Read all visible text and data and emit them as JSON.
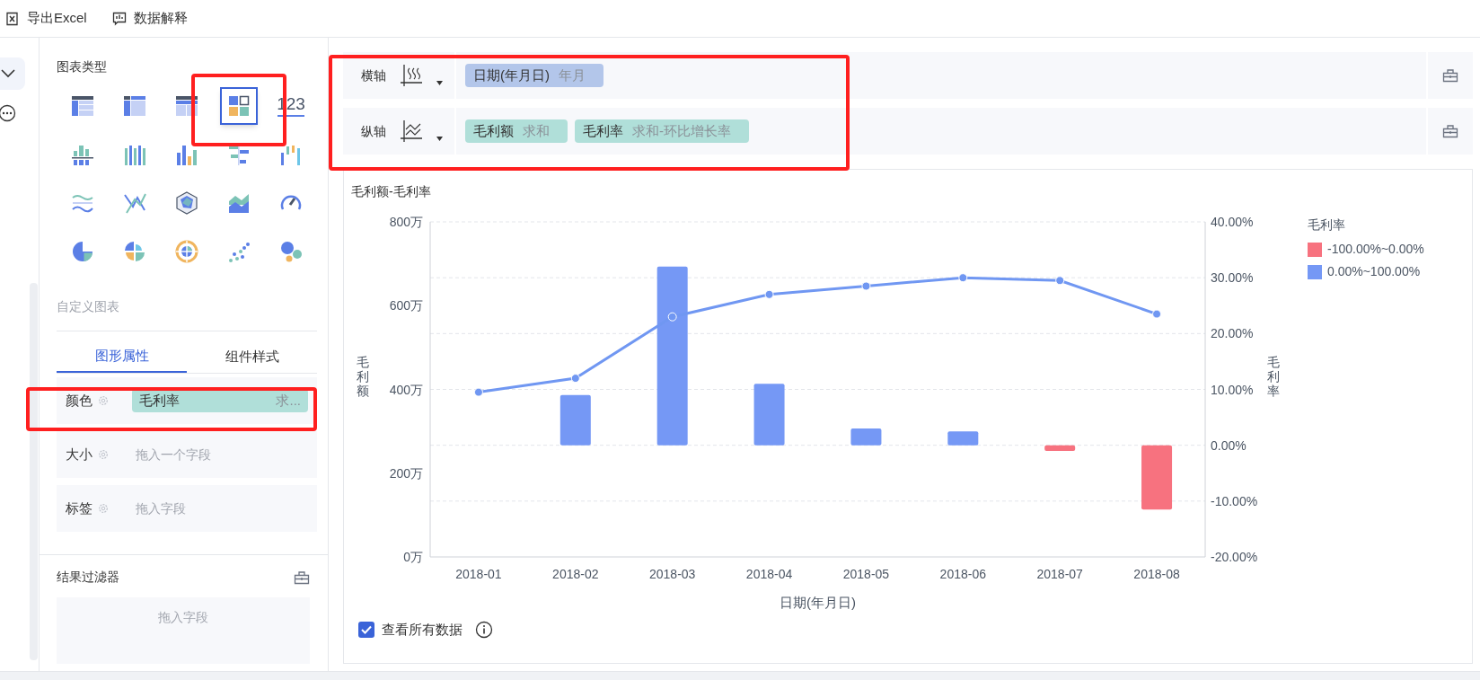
{
  "toolbar": [
    {
      "kind": "excel",
      "label": "导出Excel"
    },
    {
      "kind": "explain",
      "label": "数据解释"
    }
  ],
  "chart_types_title": "图表类型",
  "chart_types": [
    {
      "kind": "table",
      "selected": false
    },
    {
      "kind": "split-table",
      "selected": false
    },
    {
      "kind": "header-table",
      "selected": false
    },
    {
      "kind": "card-grid",
      "selected": true
    },
    {
      "kind": "number",
      "label": "123",
      "selected": false
    },
    {
      "kind": "stacked-bar",
      "selected": false
    },
    {
      "kind": "grouped-bar",
      "selected": false
    },
    {
      "kind": "column",
      "selected": false
    },
    {
      "kind": "diverging-bar",
      "selected": false
    },
    {
      "kind": "waterfall",
      "selected": false
    },
    {
      "kind": "waves",
      "selected": false
    },
    {
      "kind": "cross-lines",
      "selected": false
    },
    {
      "kind": "radar",
      "selected": false
    },
    {
      "kind": "area",
      "selected": false
    },
    {
      "kind": "gauge",
      "selected": false
    },
    {
      "kind": "pie",
      "selected": false
    },
    {
      "kind": "rose",
      "selected": false
    },
    {
      "kind": "sunburst",
      "selected": false
    },
    {
      "kind": "scatter",
      "selected": false
    },
    {
      "kind": "bubble",
      "selected": false
    }
  ],
  "custom_chart": "自定义图表",
  "tabs": [
    {
      "label": "图形属性",
      "selected": true
    },
    {
      "label": "组件样式",
      "selected": false
    }
  ],
  "properties": [
    {
      "label": "颜色",
      "field": {
        "name": "毛利率",
        "agg": "求..."
      }
    },
    {
      "label": "大小",
      "placeholder": "拖入一个字段"
    },
    {
      "label": "标签",
      "placeholder": "拖入字段"
    }
  ],
  "filter": {
    "title": "结果过滤器",
    "placeholder": "拖入字段"
  },
  "axes": [
    {
      "label": "横轴",
      "kind": "x",
      "fields": [
        {
          "name": "日期(年月日)",
          "agg": "年月",
          "color": "#b3c6ea"
        }
      ]
    },
    {
      "label": "纵轴",
      "kind": "y",
      "fields": [
        {
          "name": "毛利额",
          "agg": "求和",
          "color": "#b0dfd9"
        },
        {
          "name": "毛利率",
          "agg": "求和-环比增长率",
          "color": "#b0dfd9"
        }
      ]
    }
  ],
  "chart_data": {
    "type": "bar",
    "title": "毛利额-毛利率",
    "xlabel": "日期(年月日)",
    "ylabel": "毛利率",
    "y2label": "毛利额",
    "grid": true,
    "categories": [
      "2018-01",
      "2018-02",
      "2018-03",
      "2018-04",
      "2018-05",
      "2018-06",
      "2018-07",
      "2018-08"
    ],
    "series": [
      {
        "values": [
          null,
          9,
          32,
          11,
          3,
          2.5,
          -1,
          -11.5
        ],
        "colors": [
          null,
          "#7598f5",
          "#7598f5",
          "#7598f5",
          "#7598f5",
          "#7598f5",
          "#f7727f",
          "#f7727f"
        ]
      },
      {
        "type": "line",
        "color": "#7097f2",
        "marker": "circle",
        "values": [
          9.5,
          12,
          23,
          27,
          28.5,
          30,
          29.5,
          23.5
        ]
      }
    ],
    "ylim": [
      -20,
      40
    ],
    "yticks": [
      {
        "value": 40,
        "label": "40.00%"
      },
      {
        "value": 30,
        "label": "30.00%"
      },
      {
        "value": 20,
        "label": "20.00%"
      },
      {
        "value": 10,
        "label": "10.00%"
      },
      {
        "value": 0,
        "label": "0.00%"
      },
      {
        "value": -10,
        "label": "-10.00%"
      },
      {
        "value": -20,
        "label": "-20.00%"
      }
    ],
    "y2lim": [
      0,
      800
    ],
    "y2ticks": [
      {
        "value": 0,
        "label": "0万"
      },
      {
        "value": 200,
        "label": "200万"
      },
      {
        "value": 400,
        "label": "400万"
      },
      {
        "value": 600,
        "label": "600万"
      },
      {
        "value": 800,
        "label": "800万"
      }
    ]
  },
  "legend": {
    "title": "毛利率",
    "items": [
      {
        "label": "-100.00%~0.00%",
        "color": "#f7727f"
      },
      {
        "label": "0.00%~100.00%",
        "color": "#7598f5"
      }
    ]
  },
  "show_all": {
    "label": "查看所有数据",
    "checked": true
  }
}
